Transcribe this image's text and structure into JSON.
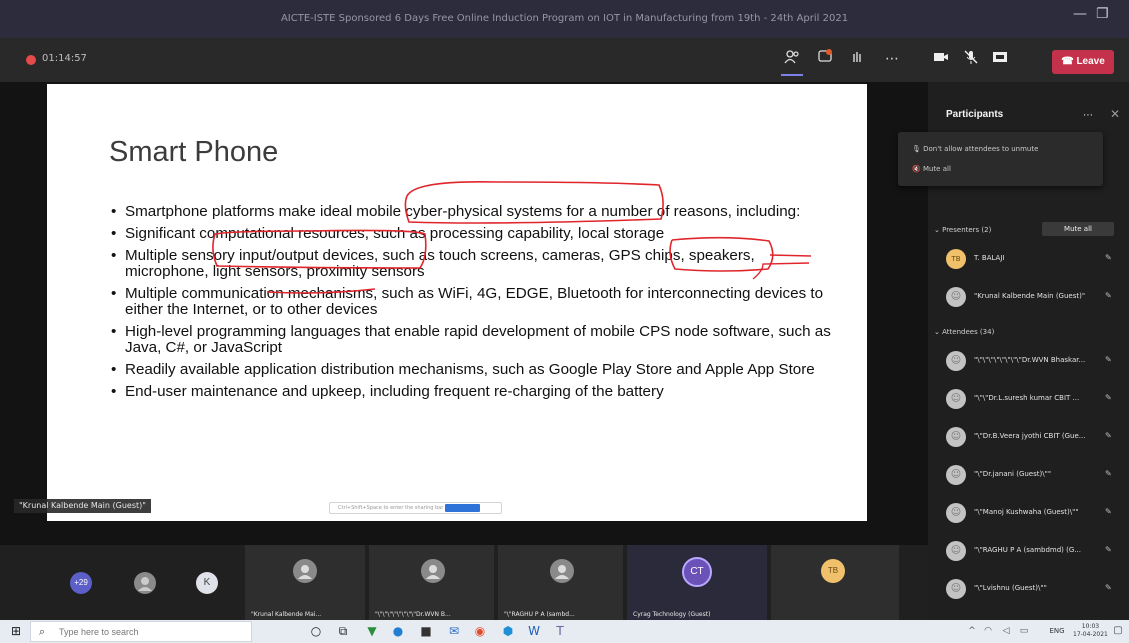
{
  "window": {
    "title": "AICTE-ISTE Sponsored 6 Days Free Online Induction Program on IOT in Manufacturing from 19th - 24th April 2021",
    "minimize": "—",
    "maximize": "❐"
  },
  "meeting": {
    "timer": "01:14:57",
    "leave_label": "Leave"
  },
  "slide": {
    "title": "Smart Phone",
    "bullets": [
      "Smartphone platforms make ideal mobile cyber-physical systems for a number of reasons, including:",
      "Significant computational resources, such as processing capability, local storage",
      "Multiple sensory input/output devices, such as touch screens, cameras, GPS chips, speakers, microphone, light sensors, proximity sensors",
      "Multiple communication mechanisms, such as WiFi, 4G, EDGE, Bluetooth for interconnecting devices to either the Internet, or to other devices",
      "High-level programming languages that enable rapid development of mobile CPS node software, such as Java, C#, or JavaScript",
      "Readily available application distribution mechanisms, such as Google Play Store and Apple App Store",
      "End-user maintenance and upkeep, including frequent re-charging of the battery"
    ],
    "presenter_tag": "\"Krunal Kalbende Main (Guest)\"",
    "share_bar_text": "Ctrl+Shift+Space to enter the sharing bar"
  },
  "tray": {
    "overflow_count": "+29",
    "k_initial": "K",
    "tiles": [
      {
        "name": "\"Krunal Kalbende Mai...",
        "initials": ""
      },
      {
        "name": "\"\\\"\\\"\\\"\\\"\\\"\\\"\\\"\\\"Dr.WVN B...",
        "initials": ""
      },
      {
        "name": "\"\\\"RAGHU P A (sambd...",
        "initials": ""
      },
      {
        "name": "Cyrag Technology (Guest)",
        "initials": "CT"
      },
      {
        "name": "",
        "initials": "TB"
      }
    ]
  },
  "participants": {
    "title": "Participants",
    "menu": [
      "Don't allow attendees to unmute",
      "Mute all"
    ],
    "presenters_label": "Presenters (2)",
    "attendees_label": "Attendees (34)",
    "mute_all_label": "Mute all",
    "presenters": [
      {
        "name": "T. BALAJI",
        "initials": "TB"
      },
      {
        "name": "\"Krunal Kalbende Main (Guest)\"",
        "initials": ""
      }
    ],
    "attendees": [
      {
        "name": "\"\\\"\\\"\\\"\\\"\\\"\\\"\\\"\\\"Dr.WVN Bhaskar..."
      },
      {
        "name": "\"\\\"\\\"Dr.L.suresh kumar CBIT ..."
      },
      {
        "name": "\"\\\"Dr.B.Veera jyothi CBIT (Gue..."
      },
      {
        "name": "\"\\\"Dr.janani (Guest)\\\"\""
      },
      {
        "name": "\"\\\"Manoj Kushwaha (Guest)\\\"\""
      },
      {
        "name": "\"\\\"RAGHU P A (sambdmd) (G..."
      },
      {
        "name": "\"\\\"Lvishnu (Guest)\\\"\""
      }
    ]
  },
  "taskbar": {
    "search_placeholder": "Type here to search",
    "time": "10:03",
    "date": "17-04-2021",
    "lang": "ENG"
  },
  "colors": {
    "leave": "#c4314b",
    "accent": "#7b83eb",
    "ink": "#e0252b"
  }
}
